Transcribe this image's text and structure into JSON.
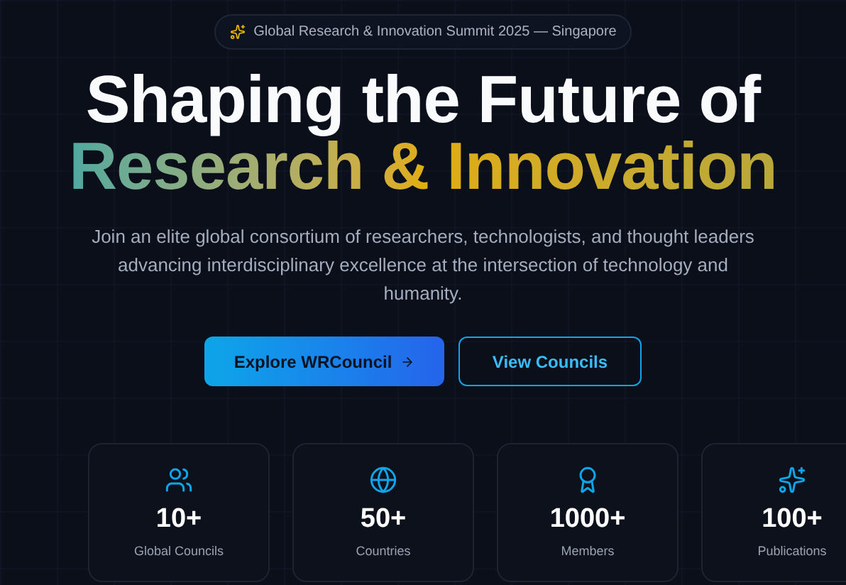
{
  "badge": {
    "text": "Global Research & Innovation Summit 2025 — Singapore"
  },
  "heading": {
    "line_1": "Shaping the Future of",
    "line_2": "Research & Innovation"
  },
  "subtitle": "Join an elite global consortium of researchers, technologists, and thought leaders advancing interdisciplinary excellence at the intersection of technology and humanity.",
  "buttons": [
    {
      "label": "Explore WRCouncil",
      "kind": "primary"
    },
    {
      "label": "View Councils",
      "kind": "outline"
    }
  ],
  "stats": [
    {
      "kind": "people",
      "value": "10+",
      "label": "Global Councils"
    },
    {
      "kind": "globe",
      "value": "50+",
      "label": "Countries"
    },
    {
      "kind": "award",
      "value": "1000+",
      "label": "Members"
    },
    {
      "kind": "sparkles",
      "value": "100+",
      "label": "Publications"
    }
  ]
}
